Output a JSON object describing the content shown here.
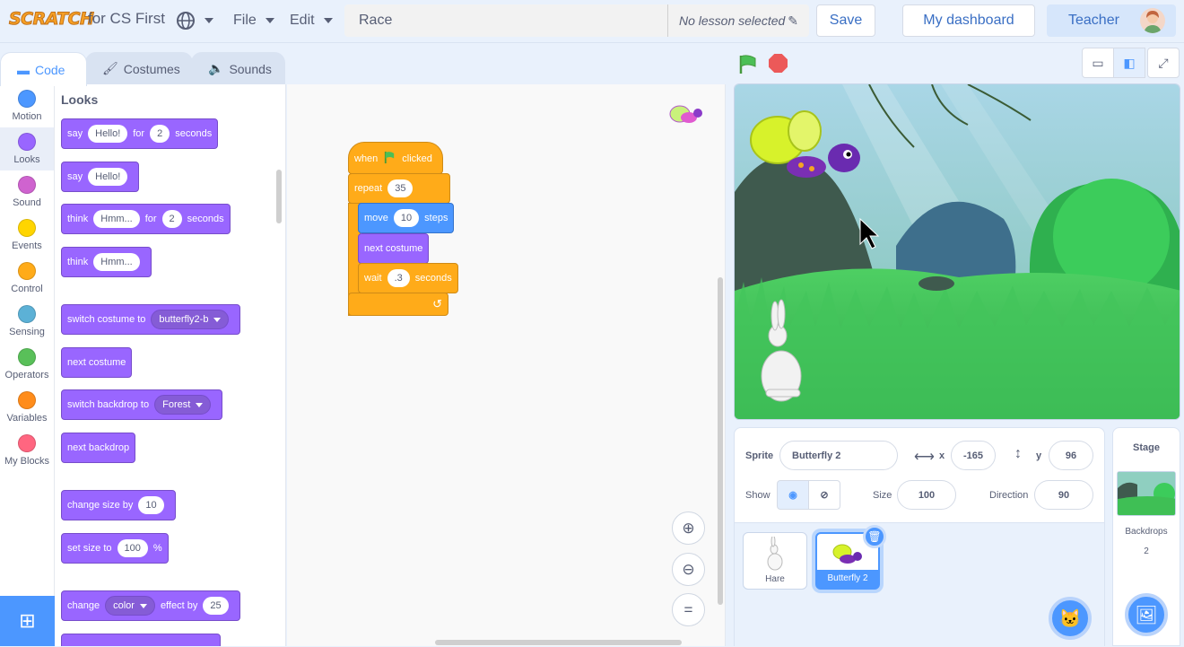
{
  "header": {
    "logo_text": "SCRATCH",
    "brand_sub": "for CS First",
    "file_label": "File",
    "edit_label": "Edit",
    "project_title": "Race",
    "lesson_text": "No lesson selected",
    "save_label": "Save",
    "dashboard_label": "My dashboard",
    "teacher_label": "Teacher"
  },
  "tabs": [
    {
      "label": "Code"
    },
    {
      "label": "Costumes"
    },
    {
      "label": "Sounds"
    }
  ],
  "categories": [
    {
      "label": "Motion",
      "color": "#4c97ff"
    },
    {
      "label": "Looks",
      "color": "#9966ff"
    },
    {
      "label": "Sound",
      "color": "#cf63cf"
    },
    {
      "label": "Events",
      "color": "#ffd500"
    },
    {
      "label": "Control",
      "color": "#ffab19"
    },
    {
      "label": "Sensing",
      "color": "#5cb1d6"
    },
    {
      "label": "Operators",
      "color": "#59c059"
    },
    {
      "label": "Variables",
      "color": "#ff8c1a"
    },
    {
      "label": "My Blocks",
      "color": "#ff6680"
    }
  ],
  "palette": {
    "title": "Looks",
    "blocks": {
      "say_for": {
        "say": "say",
        "text": "Hello!",
        "for": "for",
        "num": "2",
        "seconds": "seconds"
      },
      "say": {
        "say": "say",
        "text": "Hello!"
      },
      "think_for": {
        "think": "think",
        "text": "Hmm...",
        "for": "for",
        "num": "2",
        "seconds": "seconds"
      },
      "think": {
        "think": "think",
        "text": "Hmm..."
      },
      "switch_costume": {
        "label": "switch costume to",
        "value": "butterfly2-b"
      },
      "next_costume": {
        "label": "next costume"
      },
      "switch_backdrop": {
        "label": "switch backdrop to",
        "value": "Forest"
      },
      "next_backdrop": {
        "label": "next backdrop"
      },
      "change_size": {
        "label": "change size by",
        "num": "10"
      },
      "set_size": {
        "label": "set size to",
        "num": "100",
        "unit": "%"
      },
      "change_effect": {
        "change": "change",
        "effect": "color",
        "by": "effect by",
        "num": "25"
      }
    }
  },
  "script": {
    "when": "when",
    "clicked": "clicked",
    "repeat": "repeat",
    "repeat_count": "35",
    "move": "move",
    "move_steps": "10",
    "steps": "steps",
    "next_costume": "next costume",
    "wait": "wait",
    "wait_value": ".3",
    "seconds": "seconds"
  },
  "sprite_info": {
    "sprite_label": "Sprite",
    "sprite_name": "Butterfly 2",
    "x_label": "x",
    "x_value": "-165",
    "y_label": "y",
    "y_value": "96",
    "show_label": "Show",
    "size_label": "Size",
    "size_value": "100",
    "direction_label": "Direction",
    "direction_value": "90"
  },
  "sprites": [
    {
      "name": "Hare"
    },
    {
      "name": "Butterfly 2"
    }
  ],
  "stage_pane": {
    "title": "Stage",
    "backdrops_label": "Backdrops",
    "backdrops_count": "2"
  }
}
